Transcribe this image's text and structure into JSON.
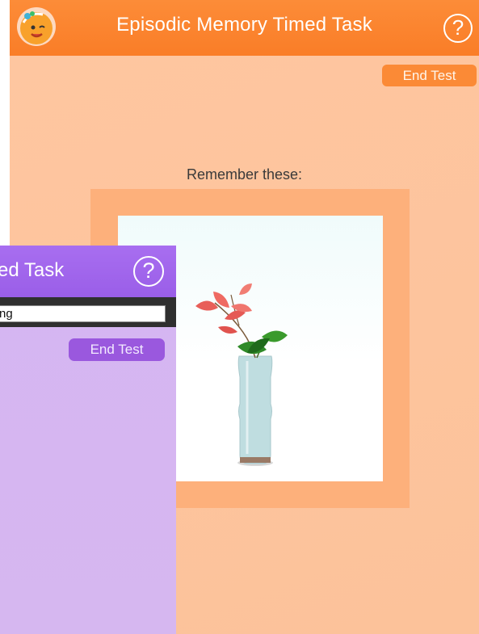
{
  "orange_window": {
    "title": "Episodic Memory Timed Task",
    "help_label": "?",
    "end_test_label": "End Test",
    "prompt": "Remember these:",
    "colors": {
      "header": "#fa7d27",
      "background": "#fec6a0",
      "frame": "#fdb07b"
    }
  },
  "purple_window": {
    "title": "ed Task",
    "help_label": "?",
    "input_value": "ng",
    "end_test_label": "End Test",
    "colors": {
      "header": "#9a5ee8",
      "background": "#d5b5f2",
      "button": "#9a58de"
    }
  },
  "stimulus": {
    "icon": "flower-vase-image"
  }
}
